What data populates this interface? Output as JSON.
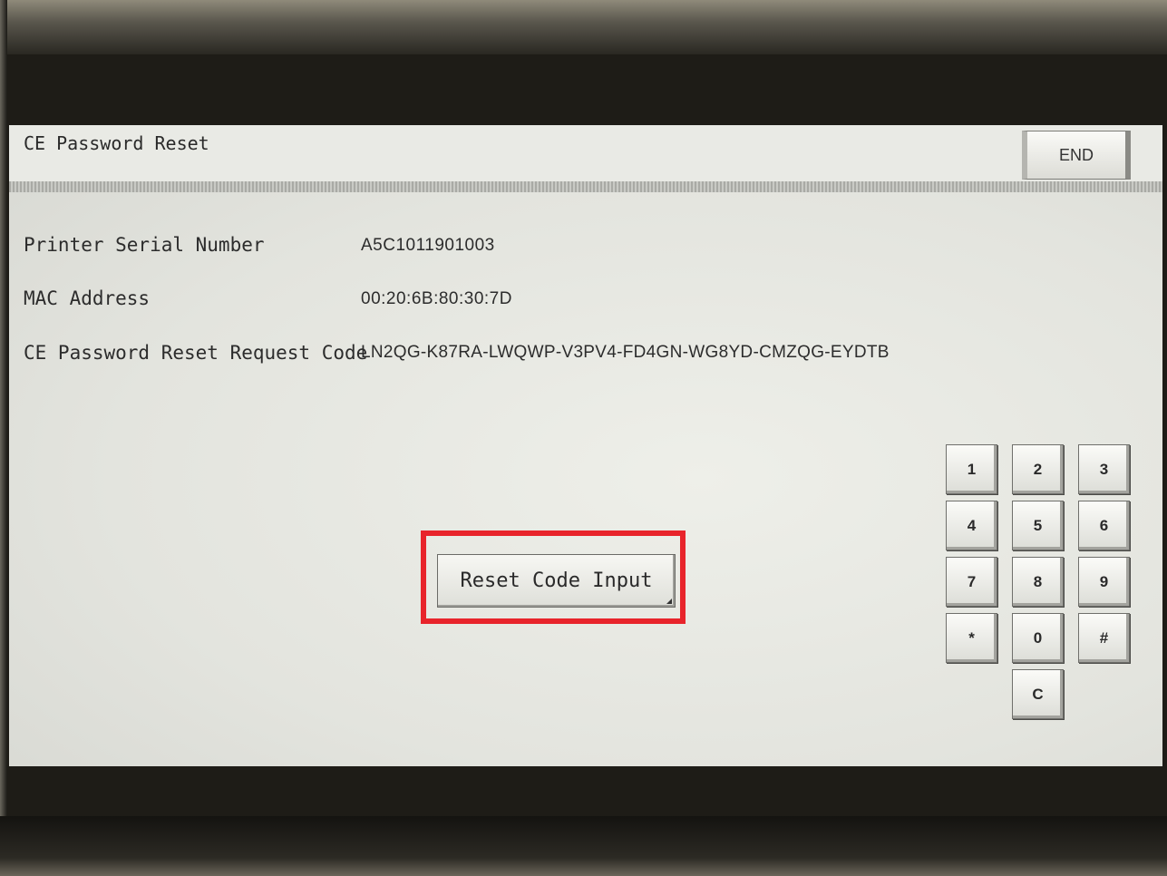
{
  "screen": {
    "title": "CE Password Reset",
    "end_label": "END"
  },
  "info": {
    "serial_label": "Printer Serial Number",
    "serial_value": "A5C1011901003",
    "mac_label": "MAC Address",
    "mac_value": "00:20:6B:80:30:7D",
    "request_label": "CE Password Reset Request Code",
    "request_value": "LN2QG-K87RA-LWQWP-V3PV4-FD4GN-WG8YD-CMZQG-EYDTB"
  },
  "reset_button_label": "Reset Code Input",
  "keypad": {
    "k1": "1",
    "k2": "2",
    "k3": "3",
    "k4": "4",
    "k5": "5",
    "k6": "6",
    "k7": "7",
    "k8": "8",
    "k9": "9",
    "kstar": "*",
    "k0": "0",
    "khash": "#",
    "kclear": "C"
  },
  "highlight_color": "#e8242b"
}
